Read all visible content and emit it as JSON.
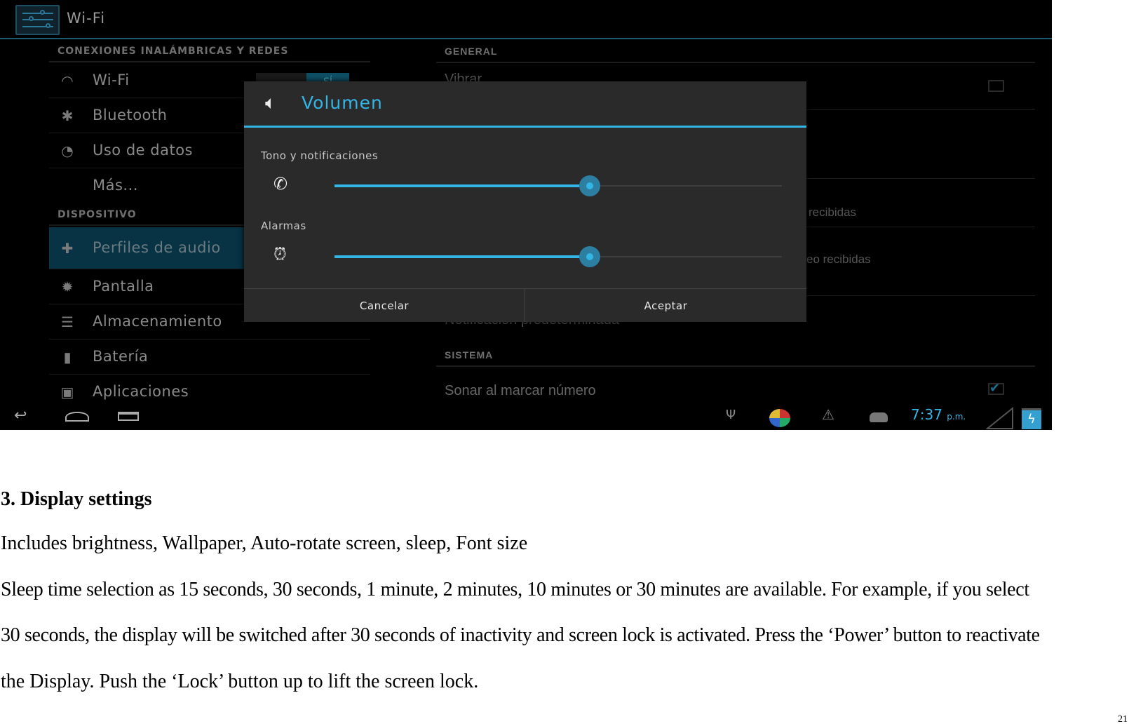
{
  "screenshot": {
    "titlebar": {
      "title": "Wi-Fi",
      "icon": "settings-sliders-icon"
    },
    "left_pane": {
      "sections": [
        {
          "header": "CONEXIONES INALÁMBRICAS Y REDES"
        },
        {
          "header": "DISPOSITIVO"
        }
      ],
      "items": [
        {
          "label": "Wi-Fi",
          "icon": "wifi-icon",
          "toggle": "SÍ"
        },
        {
          "label": "Bluetooth",
          "icon": "bluetooth-icon"
        },
        {
          "label": "Uso de datos",
          "icon": "data-usage-icon"
        },
        {
          "label": "Más..."
        },
        {
          "label": "Perfiles de audio",
          "icon": "audio-profiles-icon",
          "selected": true
        },
        {
          "label": "Pantalla",
          "icon": "brightness-icon"
        },
        {
          "label": "Almacenamiento",
          "icon": "storage-icon"
        },
        {
          "label": "Batería",
          "icon": "battery-icon"
        },
        {
          "label": "Aplicaciones",
          "icon": "apps-icon"
        }
      ]
    },
    "right_pane": {
      "general_header": "GENERAL",
      "vibrar": "Vibrar",
      "recibidas1": "recibidas",
      "recibidas2": "eo recibidas",
      "notificacion": "Notificación predeterminada",
      "sistema_header": "SISTEMA",
      "sonar": "Sonar al marcar número",
      "sonar_checked": true,
      "vibrar_checked": false
    },
    "dialog": {
      "title": "Volumen",
      "icon": "speaker-icon",
      "sliders": [
        {
          "label": "Tono y notificaciones",
          "icon": "phone-ring-icon",
          "value_percent": 57
        },
        {
          "label": "Alarmas",
          "icon": "alarm-clock-icon",
          "value_percent": 57
        }
      ],
      "cancel": "Cancelar",
      "accept": "Aceptar",
      "accent": "#33b5e5"
    },
    "navbar": {
      "time": "7:37",
      "ampm": "p.m.",
      "icons": [
        "back-icon",
        "home-icon",
        "recent-apps-icon",
        "usb-icon",
        "app-notification-icon",
        "warning-icon",
        "android-debug-icon",
        "signal-icon",
        "battery-charging-icon"
      ]
    }
  },
  "document": {
    "heading": "3. Display settings",
    "lines": [
      "Includes brightness, Wallpaper, Auto-rotate screen, sleep, Font size",
      "Sleep time selection as 15 seconds, 30 seconds, 1 minute, 2 minutes, 10 minutes or 30 minutes are available. For example, if you select",
      "30 seconds, the display will be switched after 30 seconds of inactivity and screen lock is activated. Press the ‘Power’ button to reactivate",
      "the Display. Push the ‘Lock’ button up to lift the screen lock."
    ],
    "page_number": "21"
  }
}
